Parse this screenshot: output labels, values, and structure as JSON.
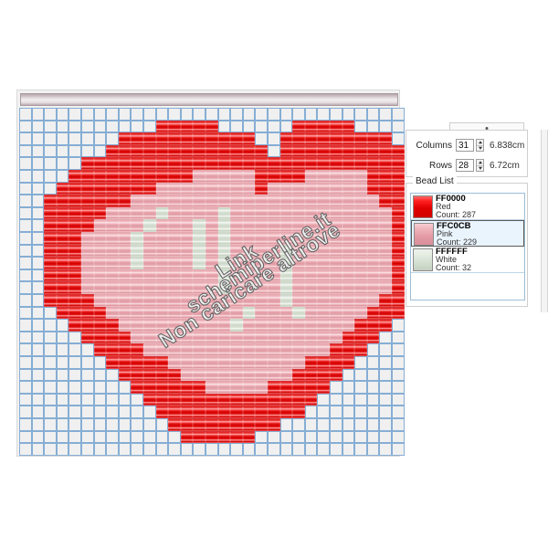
{
  "app": {
    "panel_right_label": "",
    "watermark": {
      "line1": "Link",
      "line2": "schemiperline.it",
      "line3": "Non caricare altrove"
    }
  },
  "dimensions": {
    "columns_label": "Columns",
    "columns_value": "31",
    "columns_cm": "6.838cm",
    "rows_label": "Rows",
    "rows_value": "28",
    "rows_cm": "6.72cm"
  },
  "bead_list": {
    "legend": "Bead List",
    "items": [
      {
        "hex": "FF0000",
        "name": "Red",
        "count": "Count: 287",
        "color": "#FF0000",
        "selected": false
      },
      {
        "hex": "FFC0CB",
        "name": "Pink",
        "count": "Count: 229",
        "color": "#FFC0CB",
        "selected": true
      },
      {
        "hex": "FFFFFF",
        "name": "White",
        "count": "Count: 32",
        "color": "#FFFFFF",
        "selected": false
      }
    ]
  },
  "pattern": {
    "cols": 31,
    "rows": 28,
    "legend": {
      "0": "empty",
      "1": "red",
      "2": "pink",
      "3": "white"
    },
    "colors": {
      "red": "#FF0000",
      "pink": "#FFC0CB",
      "white": "#FFFFFF"
    },
    "grid": [
      "0000000000000000000000000000000",
      "0000000000011111000000111110000",
      "0000000011111111111001111111110",
      "0000000111111111111101111111111",
      "0000011111111111111111111111111",
      "0000111111111122222111122222111",
      "0001111111122222222122222222111",
      "0011111112222222222222222222211",
      "0011111222232222322222222222221",
      "0011112222322232322222222222221",
      "0011122223222232322222222222221",
      "0011122223222232322223222222221",
      "0011122223222232322223222222221",
      "0011122222222222322223222222221",
      "0011122222222222322223222222221",
      "0011112222222222222223222222211",
      "0001111222222222223222322222111",
      "0000111122222222232222222221110",
      "0000011112222222222222222211100",
      "0000001111222222222222222111000",
      "0000000111112222222222211110000",
      "0000000011111222222222111100000",
      "0000000001111112222211111000000",
      "0000000000111111111111110000000",
      "0000000000011111111111100000000",
      "0000000000001111111110000000000",
      "0000000000000111111000000000000",
      "0000000000000000000000000000000"
    ]
  }
}
